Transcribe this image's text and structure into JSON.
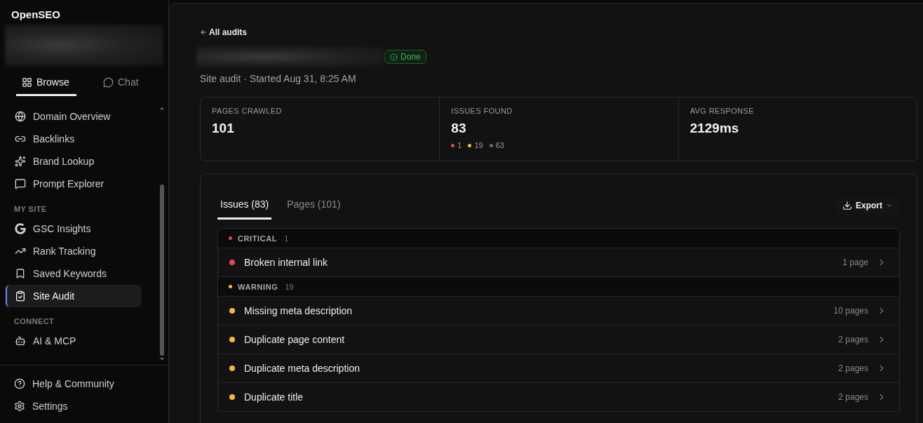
{
  "app": {
    "name": "OpenSEO"
  },
  "sidebar": {
    "tabs": [
      {
        "label": "Browse",
        "selected": true
      },
      {
        "label": "Chat",
        "selected": false
      }
    ],
    "sections": [
      {
        "items": [
          {
            "label": "Domain Overview",
            "selected": false
          },
          {
            "label": "Backlinks",
            "selected": false
          },
          {
            "label": "Brand Lookup",
            "selected": false
          },
          {
            "label": "Prompt Explorer",
            "selected": false
          }
        ]
      },
      {
        "heading": "MY SITE",
        "items": [
          {
            "label": "GSC Insights",
            "selected": false
          },
          {
            "label": "Rank Tracking",
            "selected": false
          },
          {
            "label": "Saved Keywords",
            "selected": false
          },
          {
            "label": "Site Audit",
            "selected": true
          }
        ]
      },
      {
        "heading": "CONNECT",
        "items": [
          {
            "label": "AI & MCP",
            "selected": false
          }
        ]
      }
    ],
    "footer": [
      {
        "label": "Help & Community"
      },
      {
        "label": "Settings"
      }
    ]
  },
  "main": {
    "back_link": "All audits",
    "status": "Done",
    "subtitle": "Site audit · Started Aug 31, 8:25 AM",
    "stats": [
      {
        "label": "PAGES CRAWLED",
        "value": "101"
      },
      {
        "label": "ISSUES FOUND",
        "value": "83",
        "breakdown": [
          {
            "count": "1",
            "color": "#e5484d"
          },
          {
            "count": "19",
            "color": "#f5b83d"
          },
          {
            "count": "63",
            "color": "#6b6b6b"
          }
        ]
      },
      {
        "label": "AVG RESPONSE",
        "value": "2129ms"
      }
    ],
    "tabs": [
      {
        "label": "Issues (83)",
        "selected": true
      },
      {
        "label": "Pages (101)",
        "selected": false
      }
    ],
    "export": "Export",
    "groups": [
      {
        "severity": "CRITICAL",
        "count": "1",
        "color": "#e5484d",
        "issues": [
          {
            "title": "Broken internal link",
            "pages": "1 page"
          }
        ]
      },
      {
        "severity": "WARNING",
        "count": "19",
        "color": "#f5b83d",
        "issues": [
          {
            "title": "Missing meta description",
            "pages": "10 pages"
          },
          {
            "title": "Duplicate page content",
            "pages": "2 pages"
          },
          {
            "title": "Duplicate meta description",
            "pages": "2 pages"
          },
          {
            "title": "Duplicate title",
            "pages": "2 pages"
          }
        ]
      }
    ]
  }
}
